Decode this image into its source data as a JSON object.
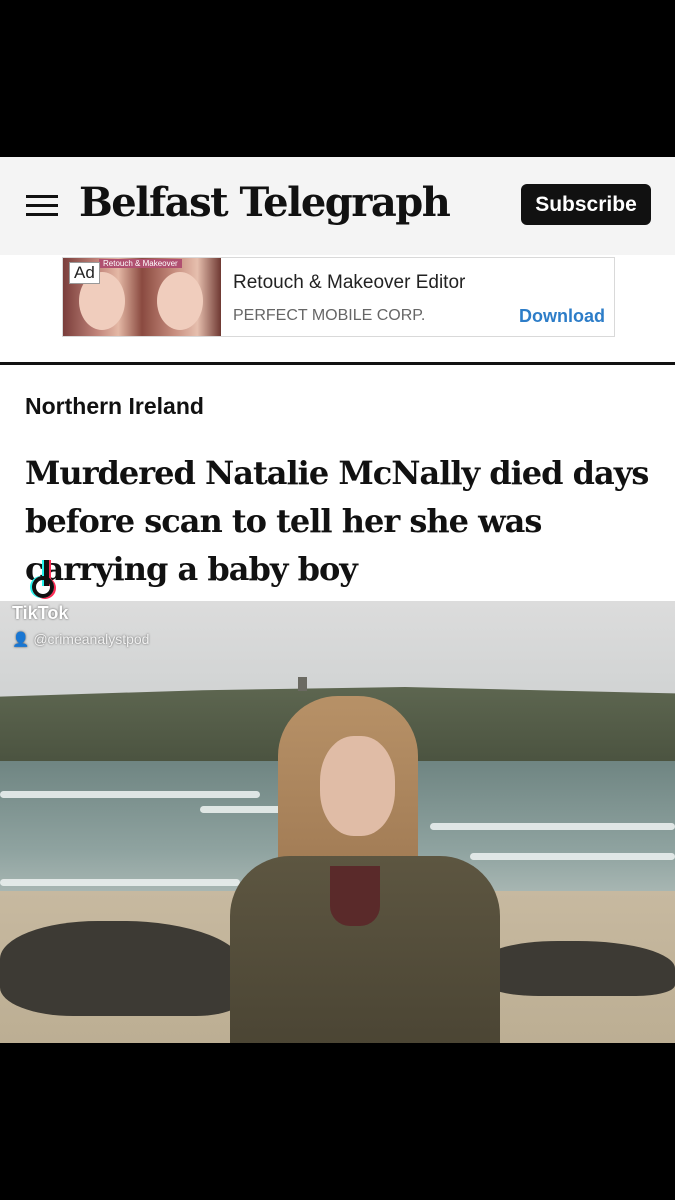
{
  "header": {
    "menu_icon": "hamburger-menu-icon",
    "masthead": "Belfast Telegraph",
    "subscribe_label": "Subscribe"
  },
  "ad": {
    "badge": "Ad",
    "banner_text": "Retouch & Makeover",
    "title": "Retouch & Makeover Editor",
    "company": "PERFECT MOBILE CORP.",
    "cta": "Download"
  },
  "article": {
    "section": "Northern Ireland",
    "headline": "Murdered Natalie McNally died days before scan to tell her she was carrying a baby boy"
  },
  "watermark": {
    "icon": "tiktok-logo-icon",
    "brand": "TikTok",
    "handle": "👤 @crimeanalystpod"
  },
  "colors": {
    "letterbox": "#000000",
    "header_bg": "#f4f4f4",
    "subscribe_bg": "#111111",
    "download_link": "#2d7dc8"
  }
}
